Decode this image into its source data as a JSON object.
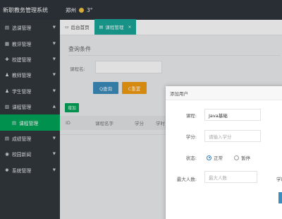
{
  "app": {
    "title": "新职教务管理系统"
  },
  "weather": {
    "city": "郑州",
    "temp": "3°"
  },
  "sidebar": {
    "items": [
      {
        "label": "选课管理",
        "icon": "document-icon"
      },
      {
        "label": "教评管理",
        "icon": "grid-icon"
      },
      {
        "label": "校建管理",
        "icon": "wrench-icon"
      },
      {
        "label": "教师管理",
        "icon": "users-icon"
      },
      {
        "label": "学生管理",
        "icon": "user-icon"
      },
      {
        "label": "课程管理",
        "icon": "book-icon"
      },
      {
        "label": "课程管理",
        "icon": "document-icon"
      },
      {
        "label": "成绩管理",
        "icon": "chart-icon"
      },
      {
        "label": "校园新闻",
        "icon": "globe-icon"
      },
      {
        "label": "系统管理",
        "icon": "settings-icon"
      }
    ]
  },
  "tabs": [
    {
      "label": "后台首页"
    },
    {
      "label": "课程管理"
    }
  ],
  "query": {
    "section_title": "查询条件",
    "course_label": "课程名:",
    "query_button": "Q查询",
    "reset_button": "C重置"
  },
  "table": {
    "add_button": "增加",
    "headers": [
      "ID",
      "课程名字",
      "学分",
      "学时"
    ]
  },
  "modal": {
    "title": "添加用户",
    "course_label": "课程:",
    "course_value": "Java基础",
    "credit_label": "学分:",
    "credit_placeholder": "请输入学分",
    "status_label": "状态:",
    "status_options": [
      "正常",
      "暂停"
    ],
    "max_label": "最大人数:",
    "max_placeholder": "最大人数",
    "extra_label": "学时"
  },
  "colors": {
    "topbar": "#2f353d",
    "sidebar": "#33383e",
    "active": "#00a65a",
    "tab_active": "#1aa79a",
    "query": "#3c8dbc",
    "reset": "#f39c12"
  }
}
